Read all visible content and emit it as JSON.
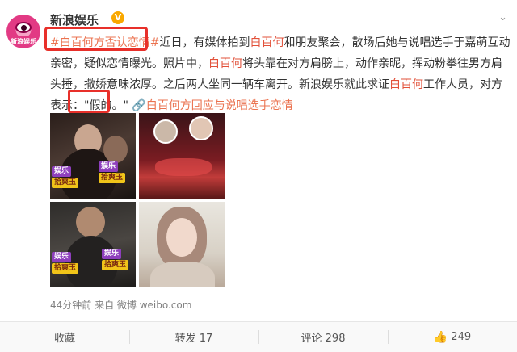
{
  "post": {
    "author": "新浪娱乐",
    "verified_badge": "V",
    "avatar_text": "新浪娱乐",
    "hashtag": "#白百何方否认恋情#",
    "text_1": "近日，有媒体拍到",
    "name_1": "白百何",
    "text_2": "和朋友聚会，散场后她与说唱选手于嘉萌互动亲密，疑似恋情曝光。照片中，",
    "name_2": "白百何",
    "text_3": "将头靠在对方肩膀上，动作亲昵，挥动粉拳往男方肩头捶，撒娇意味浓厚。之后两人坐同一辆车离开。新浪娱乐就此求证",
    "name_3": "白百何",
    "text_4": "工作人员，对方表示：",
    "quote": "\"假的。\"",
    "link_text": "白百何方回应与说唱选手恋情",
    "photo_tag_1": "娱乐",
    "photo_tag_2": "拾爽玉",
    "time_source": "44分钟前 来自 微博 weibo.com"
  },
  "actions": {
    "favorite": "收藏",
    "repost": "转发 17",
    "comment": "评论 298",
    "like": "249"
  },
  "colors": {
    "link": "#eb7350",
    "highlight_box": "#e8302a"
  }
}
